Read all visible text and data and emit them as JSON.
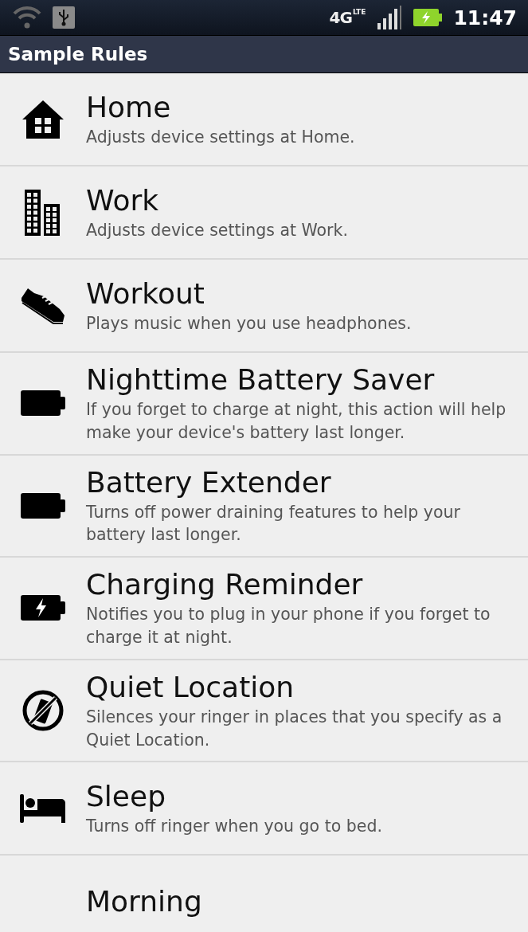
{
  "status_bar": {
    "network": "4G",
    "network_sub": "LTE",
    "time": "11:47"
  },
  "title": "Sample Rules",
  "rules": [
    {
      "kind": "home",
      "title": "Home",
      "description": "Adjusts device settings at Home."
    },
    {
      "kind": "work",
      "title": "Work",
      "description": "Adjusts device settings at Work."
    },
    {
      "kind": "workout",
      "title": "Workout",
      "description": "Plays music when you use headphones."
    },
    {
      "kind": "battery",
      "title": "Nighttime Battery Saver",
      "description": "If you forget to charge at night, this action will help make your device's battery last longer."
    },
    {
      "kind": "battery",
      "title": "Battery Extender",
      "description": "Turns off power draining features to help your battery last longer."
    },
    {
      "kind": "charging",
      "title": "Charging Reminder",
      "description": "Notifies you to plug in your phone if you forget to charge it at night."
    },
    {
      "kind": "quiet",
      "title": "Quiet Location",
      "description": "Silences your ringer in places that you specify as a Quiet Location."
    },
    {
      "kind": "sleep",
      "title": "Sleep",
      "description": "Turns off ringer when you go to bed."
    },
    {
      "kind": "partial",
      "title": "Morning"
    }
  ]
}
